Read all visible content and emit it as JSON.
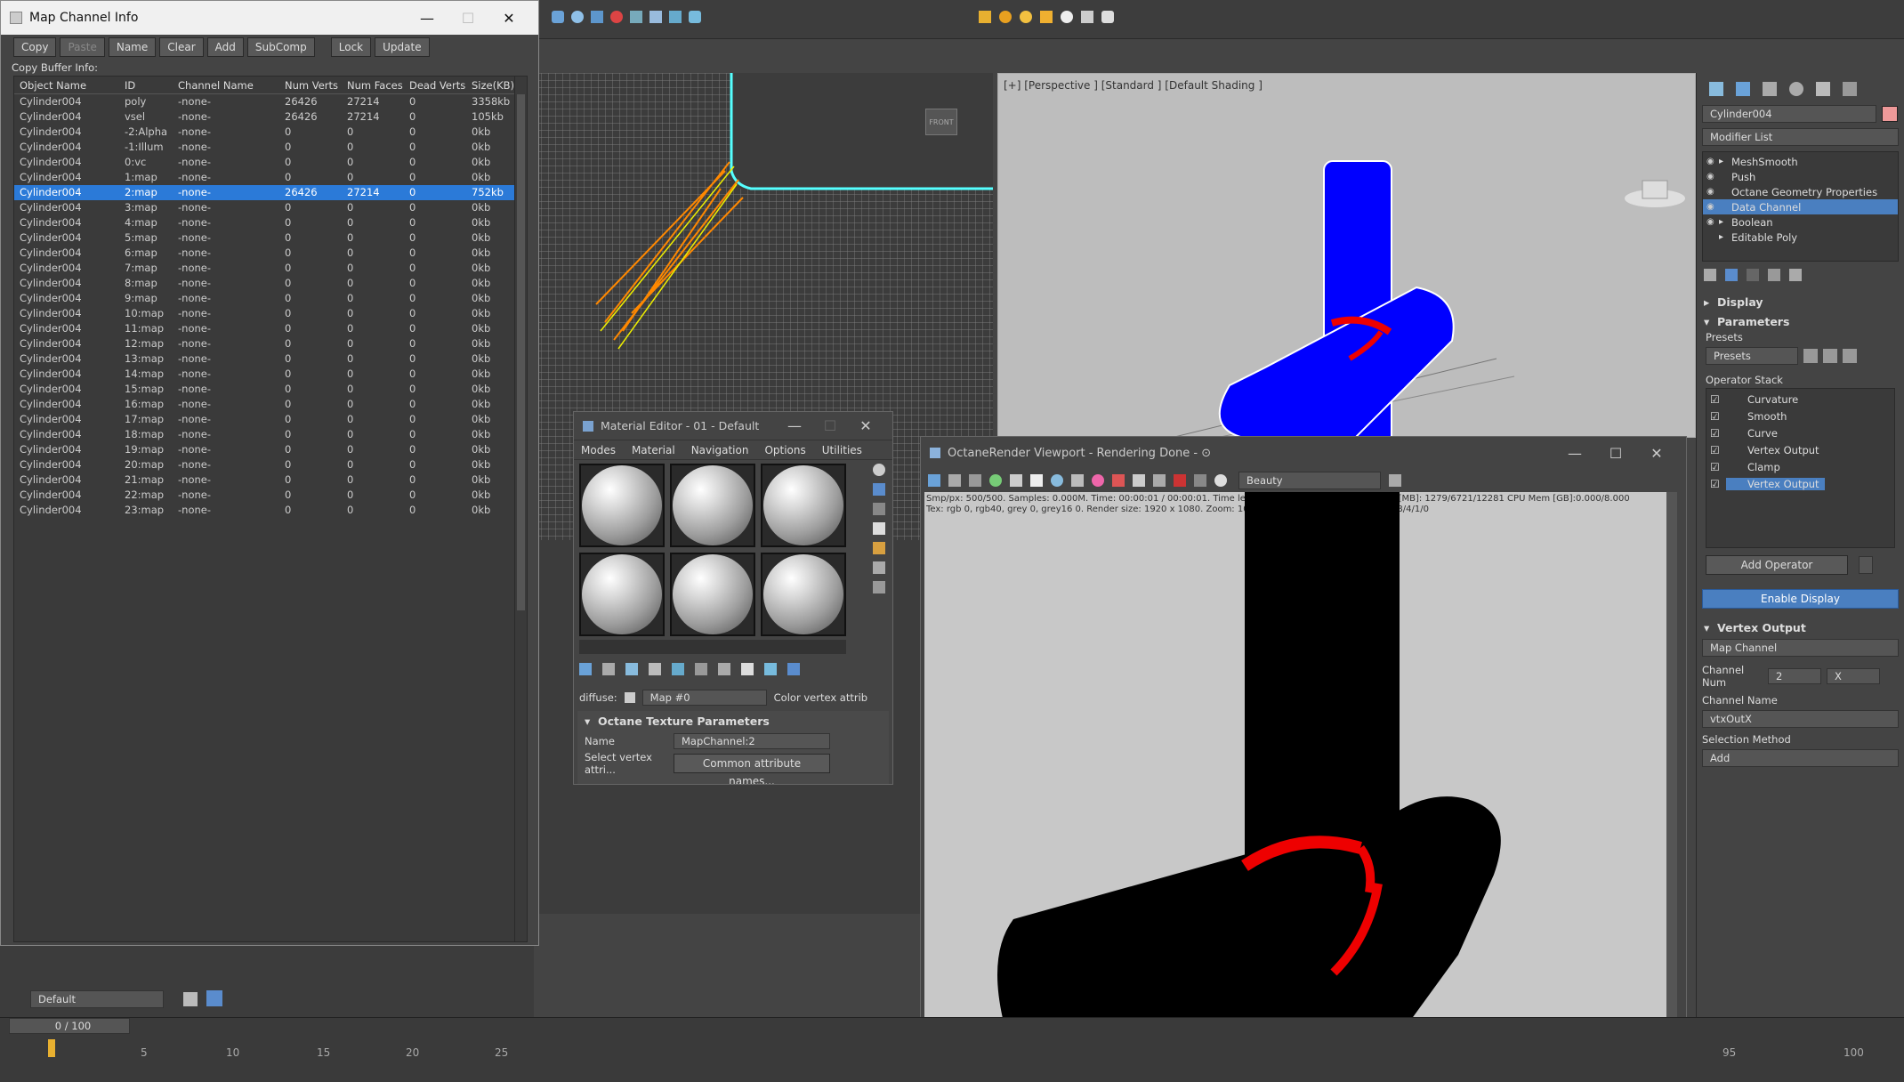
{
  "map_channel_window": {
    "title": "Map Channel Info",
    "toolbar": {
      "copy": "Copy",
      "paste": "Paste",
      "name": "Name",
      "clear": "Clear",
      "add": "Add",
      "subcomp": "SubComp",
      "lock": "Lock",
      "update": "Update"
    },
    "buffer_label": "Copy Buffer Info:",
    "columns": [
      "Object Name",
      "ID",
      "Channel Name",
      "Num Verts",
      "Num Faces",
      "Dead Verts",
      "Size(KB)"
    ],
    "rows": [
      [
        "Cylinder004",
        "poly",
        "-none-",
        "26426",
        "27214",
        "0",
        "3358kb"
      ],
      [
        "Cylinder004",
        "vsel",
        "-none-",
        "26426",
        "27214",
        "0",
        "105kb"
      ],
      [
        "Cylinder004",
        "-2:Alpha",
        "-none-",
        "0",
        "0",
        "0",
        "0kb"
      ],
      [
        "Cylinder004",
        "-1:Illum",
        "-none-",
        "0",
        "0",
        "0",
        "0kb"
      ],
      [
        "Cylinder004",
        "0:vc",
        "-none-",
        "0",
        "0",
        "0",
        "0kb"
      ],
      [
        "Cylinder004",
        "1:map",
        "-none-",
        "0",
        "0",
        "0",
        "0kb"
      ],
      [
        "Cylinder004",
        "2:map",
        "-none-",
        "26426",
        "27214",
        "0",
        "752kb"
      ],
      [
        "Cylinder004",
        "3:map",
        "-none-",
        "0",
        "0",
        "0",
        "0kb"
      ],
      [
        "Cylinder004",
        "4:map",
        "-none-",
        "0",
        "0",
        "0",
        "0kb"
      ],
      [
        "Cylinder004",
        "5:map",
        "-none-",
        "0",
        "0",
        "0",
        "0kb"
      ],
      [
        "Cylinder004",
        "6:map",
        "-none-",
        "0",
        "0",
        "0",
        "0kb"
      ],
      [
        "Cylinder004",
        "7:map",
        "-none-",
        "0",
        "0",
        "0",
        "0kb"
      ],
      [
        "Cylinder004",
        "8:map",
        "-none-",
        "0",
        "0",
        "0",
        "0kb"
      ],
      [
        "Cylinder004",
        "9:map",
        "-none-",
        "0",
        "0",
        "0",
        "0kb"
      ],
      [
        "Cylinder004",
        "10:map",
        "-none-",
        "0",
        "0",
        "0",
        "0kb"
      ],
      [
        "Cylinder004",
        "11:map",
        "-none-",
        "0",
        "0",
        "0",
        "0kb"
      ],
      [
        "Cylinder004",
        "12:map",
        "-none-",
        "0",
        "0",
        "0",
        "0kb"
      ],
      [
        "Cylinder004",
        "13:map",
        "-none-",
        "0",
        "0",
        "0",
        "0kb"
      ],
      [
        "Cylinder004",
        "14:map",
        "-none-",
        "0",
        "0",
        "0",
        "0kb"
      ],
      [
        "Cylinder004",
        "15:map",
        "-none-",
        "0",
        "0",
        "0",
        "0kb"
      ],
      [
        "Cylinder004",
        "16:map",
        "-none-",
        "0",
        "0",
        "0",
        "0kb"
      ],
      [
        "Cylinder004",
        "17:map",
        "-none-",
        "0",
        "0",
        "0",
        "0kb"
      ],
      [
        "Cylinder004",
        "18:map",
        "-none-",
        "0",
        "0",
        "0",
        "0kb"
      ],
      [
        "Cylinder004",
        "19:map",
        "-none-",
        "0",
        "0",
        "0",
        "0kb"
      ],
      [
        "Cylinder004",
        "20:map",
        "-none-",
        "0",
        "0",
        "0",
        "0kb"
      ],
      [
        "Cylinder004",
        "21:map",
        "-none-",
        "0",
        "0",
        "0",
        "0kb"
      ],
      [
        "Cylinder004",
        "22:map",
        "-none-",
        "0",
        "0",
        "0",
        "0kb"
      ],
      [
        "Cylinder004",
        "23:map",
        "-none-",
        "0",
        "0",
        "0",
        "0kb"
      ]
    ],
    "selected_row": 6
  },
  "viewport_label": "[+] [Perspective ] [Standard ] [Default Shading ]",
  "viewcube_label": "FRONT",
  "material_editor": {
    "title": "Material Editor - 01 - Default",
    "menu": [
      "Modes",
      "Material",
      "Navigation",
      "Options",
      "Utilities"
    ],
    "diffuse_label": "diffuse:",
    "map_value": "Map #0",
    "color_vertex": "Color vertex attrib",
    "section_title": "Octane Texture Parameters",
    "name_label": "Name",
    "name_value": "MapChannel:2",
    "select_label": "Select vertex attri...",
    "common_btn": "Common attribute names..."
  },
  "octane_window": {
    "title": "OctaneRender Viewport - Rendering Done - ⊙",
    "pass": "Beauty",
    "status1": "Smp/px: 500/500.   Samples: 0.000M.   Time: 00:00:01 / 00:00:01.   Time left: 00:00:01 / 00:00:00.   GPU Mem [MB]: 1279/6721/12281   CPU Mem [GB]:0.000/8.000",
    "status2": "Tex: rgb 0, rgb40, grey 0, grey16 0.   Render size: 1920 x 1080.   Zoom: 100%.   Primitives/Meshes/Voxels: 528/4/1/0"
  },
  "command_panel": {
    "object_name": "Cylinder004",
    "modifier_list": "Modifier List",
    "stack": [
      "MeshSmooth",
      "Push",
      "Octane Geometry Properties",
      "Data Channel",
      "Boolean",
      "Editable Poly"
    ],
    "stack_selected": 3,
    "display_rollout": "Display",
    "parameters_rollout": "Parameters",
    "presets_label": "Presets",
    "presets_value": "Presets",
    "operator_stack_label": "Operator Stack",
    "operators": [
      "Curvature",
      "Smooth",
      "Curve",
      "Vertex Output",
      "Clamp",
      "Vertex Output"
    ],
    "operator_selected": 5,
    "add_operator": "Add Operator",
    "enable_display": "Enable Display",
    "vertex_output_rollout": "Vertex Output",
    "map_channel_value": "Map Channel",
    "channel_num_label": "Channel Num",
    "channel_num_value": "2",
    "channel_axis": "X",
    "channel_name_label": "Channel Name",
    "channel_name_value": "vtxOutX",
    "selection_method_label": "Selection Method",
    "selection_method_value": "Add"
  },
  "bottom": {
    "layer": "Default",
    "time": "0 / 100",
    "ticks_left": [
      "5",
      "10",
      "15",
      "20",
      "25"
    ],
    "ticks_right": [
      "95",
      "100"
    ]
  },
  "colors": {
    "accent": "#2b7ad8",
    "selected_panel": "#4a7fc0",
    "mesh_blue": "#0000ff",
    "ring_red": "#e00000"
  }
}
